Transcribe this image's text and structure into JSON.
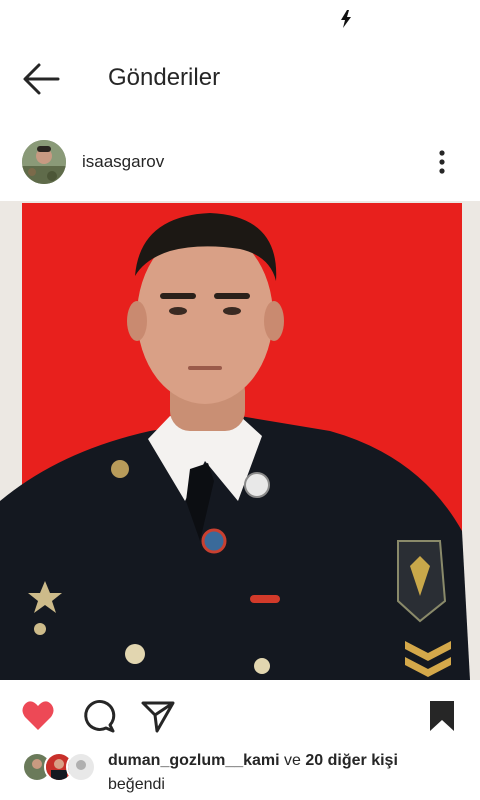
{
  "status_bar": {
    "icon": "flash-icon"
  },
  "header": {
    "title": "Gönderiler",
    "back_icon": "arrow-left-icon"
  },
  "post": {
    "username": "isaasgarov",
    "more_icon": "more-vertical-icon",
    "image_alt": "Portrait photo of man in dark uniform against red background",
    "liked": true
  },
  "likes": {
    "first_user": "duman_gozlum__kami",
    "connector": " ve ",
    "others": "20 diğer kişi",
    "suffix": "beğendi"
  },
  "colors": {
    "like_red": "#ed4956",
    "text": "#262626",
    "photo_bg": "#e8201d"
  }
}
